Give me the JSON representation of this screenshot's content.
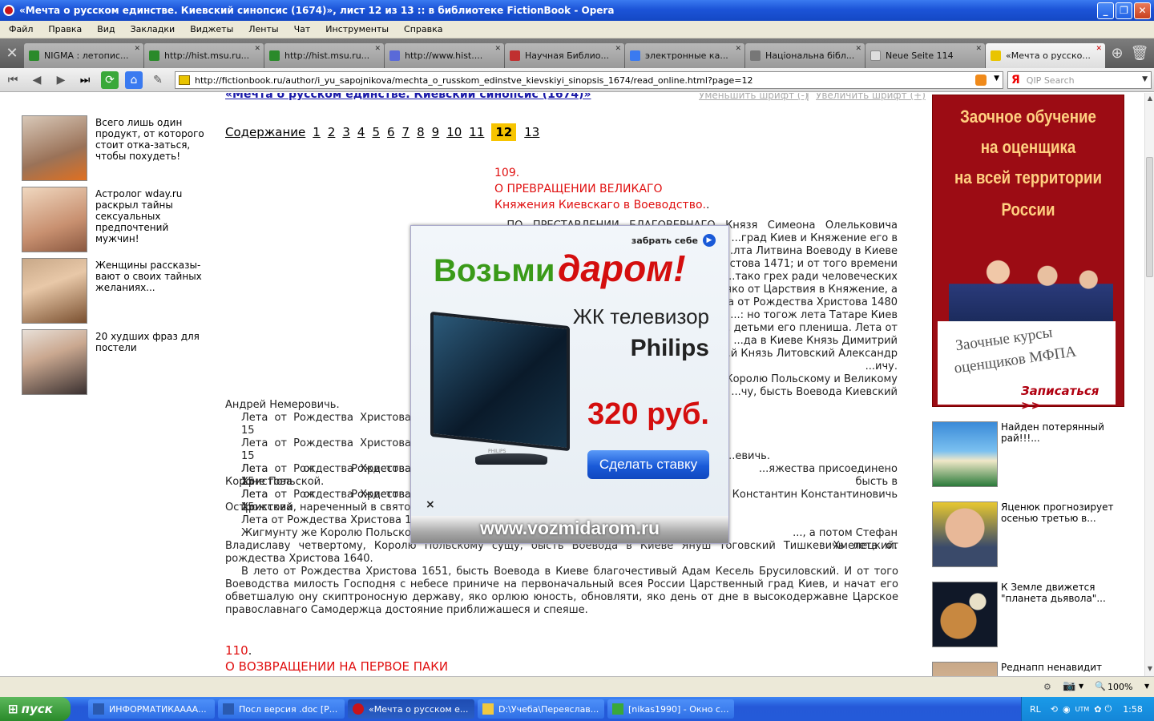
{
  "window": {
    "title": "«Мечта о русском единстве. Киевский синопсис (1674)», лист 12 из 13 :: в библиотеке FictionBook - Opera"
  },
  "menu": [
    "Файл",
    "Правка",
    "Вид",
    "Закладки",
    "Виджеты",
    "Ленты",
    "Чат",
    "Инструменты",
    "Справка"
  ],
  "tabs": [
    {
      "label": "NIGMA : летопис...",
      "color": "#2a8a2a"
    },
    {
      "label": "http://hist.msu.ru...",
      "color": "#2a8a2a"
    },
    {
      "label": "http://hist.msu.ru...",
      "color": "#2a8a2a"
    },
    {
      "label": "http://www.hist....",
      "color": "#5a6ad8"
    },
    {
      "label": "Научная Библио...",
      "color": "#c03030"
    },
    {
      "label": "электронные ка...",
      "color": "#3a7af0"
    },
    {
      "label": "Національна бібл...",
      "color": "#777777"
    },
    {
      "label": "Neue Seite 114",
      "color": "#dddddd"
    },
    {
      "label": "«Мечта о русско...",
      "color": "#e9c400"
    }
  ],
  "address": {
    "url": "http://fictionbook.ru/author/i_yu_sapojnikova/mechta_o_russkom_edinstve_kievskiyi_sinopsis_1674/read_online.html?page=12",
    "search_placeholder": "QIP Search",
    "search_engine": "Я"
  },
  "page": {
    "title_link": "«Мечта о русском единстве. Киевский синопсис (1674)»",
    "font_smaller": "Уменьшить шрифт (-)",
    "font_larger": "Увеличить шрифт (+)",
    "toc_label": "Содержание",
    "pages": [
      "1",
      "2",
      "3",
      "4",
      "5",
      "6",
      "7",
      "8",
      "9",
      "10",
      "11"
    ],
    "current_page": "12",
    "last_page": "13",
    "sec109": {
      "num": "109.",
      "h1": "О ПРЕВРАЩЕНИИ ВЕЛИКАГО",
      "h2": "Княжения Киевскаго в Воеводство."
    },
    "sec109_lines": [
      "...ПО ПРЕСТАВЛЕНИИ БЛАГОВЕРНАГО Князя Симеона Олельковича",
      "...град Киев и Княжение его в",
      "...лта Литвина Воеводу в Киеве",
      "...стова 1471; и от того времени",
      "...тако грех ради человеческих",
      "...яко от Царствия в Княжение, а",
      "...а от Рождества Христова 1480",
      "...: но тогож лета Татаре Киев",
      "... детьми его плениша. Лета от",
      "...да в Киеве Князь Димитрий",
      "...й Князь Литовский Александр",
      "...ичу.",
      "...Королю Польскому и Великому",
      "...чу, бысть Воевода Киевский"
    ],
    "line_andrey": "Андрей Немеровичь.",
    "left_lines": [
      "Лета от Рождества Христова 15",
      "Лета от Рождества Христова 15",
      "Лета от Рождества Христова 15",
      "Лета от Рождества Христова 15"
    ],
    "right_vich": "...евичь.",
    "korona1": "Лета от Рождества Христова",
    "korona1b": "...яжества присоединено бысть в",
    "korona2": "Короне Польской.",
    "ostrog1": "Лета от Рождества Христова",
    "ostrog1b": "Константин Константиновичь",
    "ostrog2": "Острожский, нареченный в святом",
    "line16": "Лета от Рождества Христова 16",
    "zhig1": "Жигмунту же Королю Польском",
    "zhig1b": "..., а потом Стефан Хмелецкий.",
    "para_end": "Владиславу четвертому, Королю Польскому сущу, бысть Воевода в Киеве Януш Тоговский Тишкевичь лета от рождества Христова 1640.",
    "para_last": "В лето от Рождества Христова 1651, бысть Воевода в Киеве благочестивый Адам Кесель Брусиловский. И от того Воеводства милость Господня с небесе приниче на первоначальный всея России Царственный град Киев, и начат его обветшалую ону скиптроносную державу, яко орлюю юность, обновляти, яко день от дне в высокодержавне Царское православнаго Самодержца достояние приближашеся и спеяше.",
    "sec110": {
      "num": "110",
      "dot": ".",
      "h1": "О ВОЗВРАЩЕНИИ НА ПЕРВОЕ ПАКИ"
    }
  },
  "left_ads": [
    "Всего лишь один продукт, от которого стоит отка-заться, чтобы похудеть!",
    "Астролог wday.ru раскрыл тайны сексуальных предпочтений мужчин!",
    "Женщины рассказы-вают о своих тайных желаниях...",
    "20 худших фраз для постели"
  ],
  "right_banner": {
    "l1": "Заочное обучение",
    "l2": "на оценщика",
    "l3": "на всей территории",
    "l4": "России",
    "card1": "Заочные курсы",
    "card2": "оценщиков МФПА",
    "cta": "Записаться >>"
  },
  "right_ads": [
    "Найден потерянный рай!!!...",
    "Яценюк прогнозирует осенью третью в...",
    "К Земле движется \"планета дьявола\"...",
    "Реднапп ненавидит"
  ],
  "popup": {
    "take": "забрать себе",
    "w1": "Возьми",
    "w2": "даром!",
    "product1": "ЖК телевизор",
    "product2": "Philips",
    "price": "320 руб.",
    "button": "Сделать ставку",
    "close": "×",
    "site": "www.vozmidarom.ru",
    "tv_brand": "PHILIPS"
  },
  "status": {
    "zoom": "100%"
  },
  "taskbar": {
    "start": "пуск",
    "tasks": [
      "ИНФОРМАТИКАААА...",
      "Посл версия .doc [Р...",
      "«Мечта о русском е...",
      "D:\\Учеба\\Переяслав...",
      "[nikas1990] - Окно с..."
    ],
    "lang": "RL",
    "clock": "1:58"
  }
}
